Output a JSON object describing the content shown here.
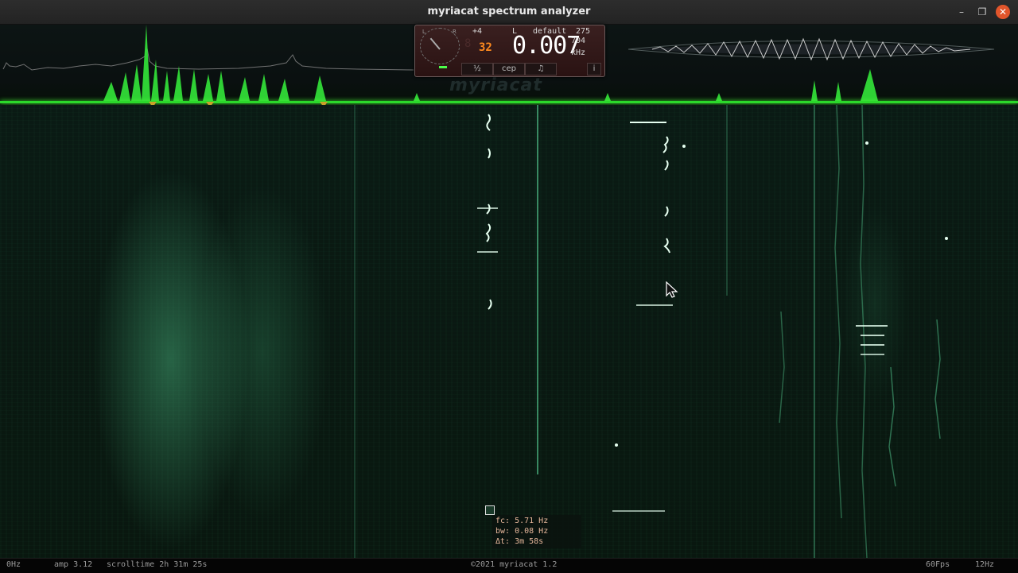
{
  "window": {
    "title": "myriacat spectrum analyzer"
  },
  "titlebar_icons": {
    "minimize": "minimize-icon",
    "maximize": "maximize-icon",
    "close": "close-icon"
  },
  "panel": {
    "dial_left": "L",
    "dial_right": "R",
    "transpose": "+4",
    "channel": "L",
    "preset": "default",
    "value_right": "275",
    "octave": "32",
    "frequency": "0.007",
    "frequency_small": "704",
    "frequency_unit": "kHz",
    "tabs": [
      "½",
      "cep",
      "♫",
      "i"
    ]
  },
  "watermark": "myriacat",
  "info": {
    "fc": "fc: 5.71 Hz",
    "bw": "bw: 0.08 Hz",
    "dt": "Δt: 3m 58s"
  },
  "status": {
    "left_freq": "0Hz",
    "amp": "amp 3.12",
    "scrolltime": "scrolltime 2h 31m 25s",
    "copyright": "©2021 myriacat 1.2",
    "fps": "60Fps",
    "right_freq": "12Hz"
  },
  "colors": {
    "accent_green": "#2bd82b",
    "waterfall": "#09170f",
    "close_button": "#e2552b",
    "octave": "#ff8a1e"
  }
}
